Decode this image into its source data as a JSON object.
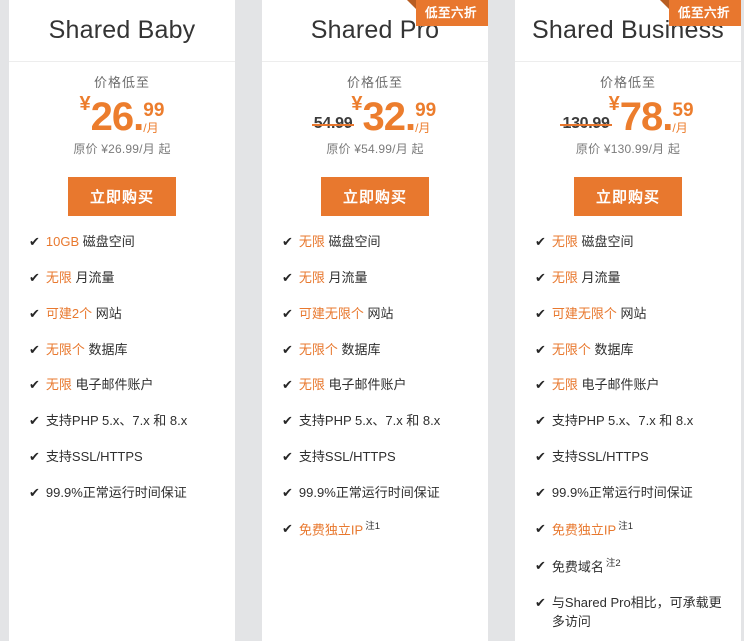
{
  "colors": {
    "accent": "#e8782e",
    "price": "#ec7d2d",
    "page_bg": "#e3e4e6",
    "card_bg": "#ffffff",
    "title": "#343434"
  },
  "icons": {
    "check": "✔",
    "yen": "¥"
  },
  "plans": [
    {
      "id": "shared-baby",
      "title": "Shared Baby",
      "ribbon": null,
      "price": {
        "kicker": "价格低至",
        "strike": null,
        "currency": "¥",
        "integer": "26",
        "fraction": "99",
        "period": "/月",
        "original": "原价 ¥26.99/月 起"
      },
      "buy_label": "立即购买",
      "features": [
        {
          "highlight": "10GB",
          "text": " 磁盘空间",
          "note": null
        },
        {
          "highlight": "无限",
          "text": " 月流量",
          "note": null
        },
        {
          "highlight": "可建2个",
          "text": " 网站",
          "note": null
        },
        {
          "highlight": "无限个",
          "text": " 数据库",
          "note": null
        },
        {
          "highlight": "无限",
          "text": " 电子邮件账户",
          "note": null
        },
        {
          "highlight": null,
          "text": "支持PHP 5.x、7.x 和 8.x",
          "note": null
        },
        {
          "highlight": null,
          "text": "支持SSL/HTTPS",
          "note": null
        },
        {
          "highlight": null,
          "text": "99.9%正常运行时间保证",
          "note": null
        }
      ]
    },
    {
      "id": "shared-pro",
      "title": "Shared Pro",
      "ribbon": "低至六折",
      "price": {
        "kicker": "价格低至",
        "strike": "54.99",
        "currency": "¥",
        "integer": "32",
        "fraction": "99",
        "period": "/月",
        "original": "原价 ¥54.99/月 起"
      },
      "buy_label": "立即购买",
      "features": [
        {
          "highlight": "无限",
          "text": " 磁盘空间",
          "note": null
        },
        {
          "highlight": "无限",
          "text": " 月流量",
          "note": null
        },
        {
          "highlight": "可建无限个",
          "text": " 网站",
          "note": null
        },
        {
          "highlight": "无限个",
          "text": " 数据库",
          "note": null
        },
        {
          "highlight": "无限",
          "text": " 电子邮件账户",
          "note": null
        },
        {
          "highlight": null,
          "text": "支持PHP 5.x、7.x 和 8.x",
          "note": null
        },
        {
          "highlight": null,
          "text": "支持SSL/HTTPS",
          "note": null
        },
        {
          "highlight": null,
          "text": "99.9%正常运行时间保证",
          "note": null
        },
        {
          "highlight": "免费独立IP",
          "text": "",
          "note": "注1"
        }
      ]
    },
    {
      "id": "shared-business",
      "title": "Shared Business",
      "ribbon": "低至六折",
      "price": {
        "kicker": "价格低至",
        "strike": "130.99",
        "currency": "¥",
        "integer": "78",
        "fraction": "59",
        "period": "/月",
        "original": "原价 ¥130.99/月 起"
      },
      "buy_label": "立即购买",
      "features": [
        {
          "highlight": "无限",
          "text": " 磁盘空间",
          "note": null
        },
        {
          "highlight": "无限",
          "text": " 月流量",
          "note": null
        },
        {
          "highlight": "可建无限个",
          "text": " 网站",
          "note": null
        },
        {
          "highlight": "无限个",
          "text": " 数据库",
          "note": null
        },
        {
          "highlight": "无限",
          "text": " 电子邮件账户",
          "note": null
        },
        {
          "highlight": null,
          "text": "支持PHP 5.x、7.x 和 8.x",
          "note": null
        },
        {
          "highlight": null,
          "text": "支持SSL/HTTPS",
          "note": null
        },
        {
          "highlight": null,
          "text": "99.9%正常运行时间保证",
          "note": null
        },
        {
          "highlight": "免费独立IP",
          "text": "",
          "note": "注1"
        },
        {
          "highlight": null,
          "text": "免费域名",
          "note": "注2"
        },
        {
          "highlight": null,
          "text": "与Shared Pro相比，可承载更多访问",
          "note": null
        }
      ]
    }
  ]
}
